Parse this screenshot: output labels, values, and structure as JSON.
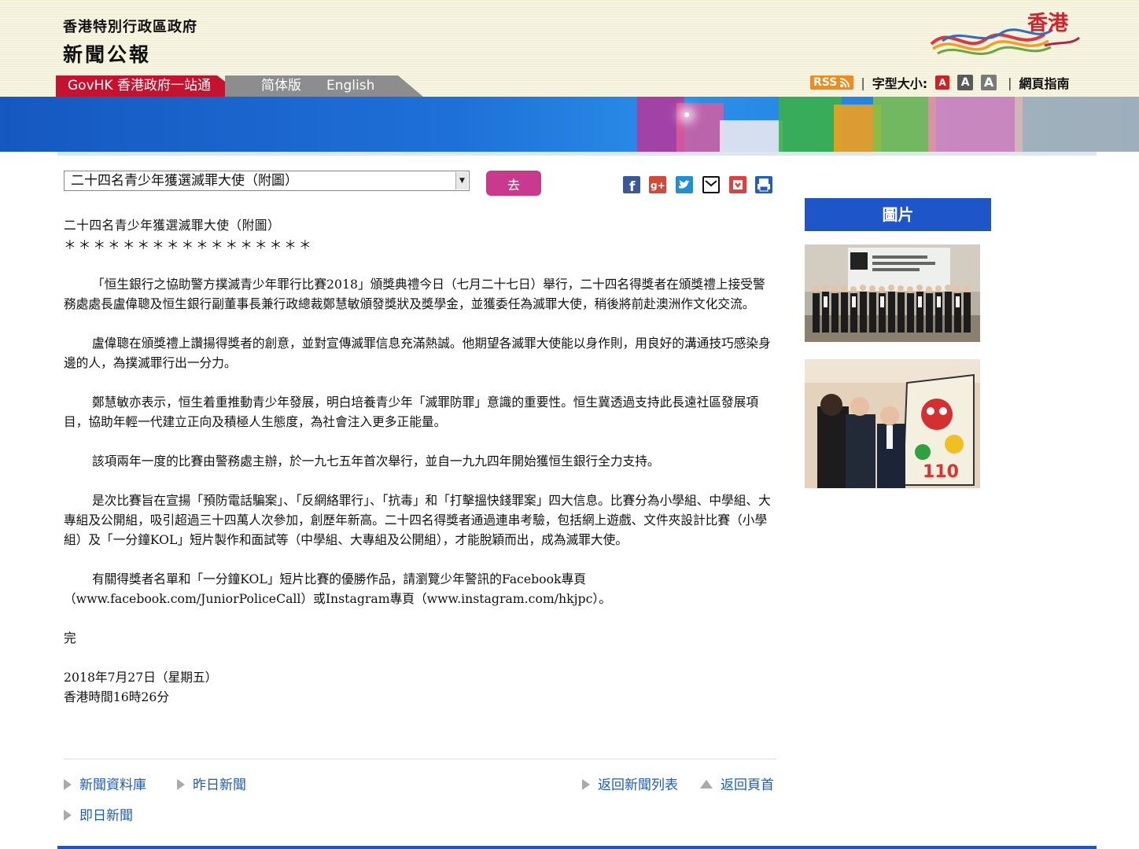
{
  "header": {
    "title_line1": "香港特別行政區政府",
    "title_line2": "新聞公報",
    "logo_text": "香港",
    "nav": {
      "govhk": "GovHK 香港政府一站通",
      "simplified": "简体版",
      "english": "English"
    },
    "utility": {
      "rss": "RSS",
      "font_size_label": "字型大小:",
      "font_a": "A",
      "guide": "網頁指南"
    }
  },
  "selector": {
    "selected": "二十四名青少年獲選滅罪大使（附圖）",
    "go_label": "去"
  },
  "share_icons": [
    "facebook-icon",
    "google-plus-icon",
    "twitter-icon",
    "email-icon",
    "bookmark-icon",
    "print-icon"
  ],
  "article": {
    "title": "二十四名青少年獲選滅罪大使（附圖）",
    "stars": "＊＊＊＊＊＊＊＊＊＊＊＊＊＊＊＊＊",
    "paragraphs": [
      "「恒生銀行之協助警方撲滅青少年罪行比賽2018」頒獎典禮今日（七月二十七日）舉行，二十四名得獎者在頒獎禮上接受警務處處長盧偉聰及恒生銀行副董事長兼行政總裁鄭慧敏頒發獎狀及獎學金，並獲委任為滅罪大使，稍後將前赴澳洲作文化交流。",
      "盧偉聰在頒獎禮上讚揚得獎者的創意，並對宣傳滅罪信息充滿熱誠。他期望各滅罪大使能以身作則，用良好的溝通技巧感染身邊的人，為撲滅罪行出一分力。",
      "鄭慧敏亦表示，恒生着重推動青少年發展，明白培養青少年「滅罪防罪」意識的重要性。恒生冀透過支持此長遠社區發展項目，協助年輕一代建立正向及積極人生態度，為社會注入更多正能量。",
      "該項兩年一度的比賽由警務處主辦，於一九七五年首次舉行，並自一九九四年開始獲恒生銀行全力支持。",
      "是次比賽旨在宣揚「預防電話騙案」、「反網絡罪行」、「抗毒」和「打擊搵快錢罪案」四大信息。比賽分為小學組、中學組、大專組及公開組，吸引超過三十四萬人次參加，創歷年新高。二十四名得獎者通過連串考驗，包括網上遊戲、文件夾設計比賽（小學組）及「一分鐘KOL」短片製作和面試等（中學組、大專組及公開組），才能脫穎而出，成為滅罪大使。",
      "有關得獎者名單和「一分鐘KOL」短片比賽的優勝作品，請瀏覽少年警訊的Facebook專頁（www.facebook.com/JuniorPoliceCall）或Instagram專頁（www.instagram.com/hkjpc）。"
    ],
    "end": "完",
    "date": "2018年7月27日（星期五）",
    "time": "香港時間16時26分"
  },
  "links": {
    "archive": "新聞資料庫",
    "yesterday": "昨日新聞",
    "back_list": "返回新聞列表",
    "back_top": "返回頁首",
    "today": "即日新聞"
  },
  "sidebar": {
    "photos_heading": "圖片"
  },
  "colors": {
    "brand_red": "#c4122f",
    "nav_grey": "#8d8d8d",
    "banner_blue": "#1e70d8",
    "go_pink": "#c93a8e",
    "link_blue": "#1d5db3",
    "photo_header_blue": "#1e55c8"
  }
}
